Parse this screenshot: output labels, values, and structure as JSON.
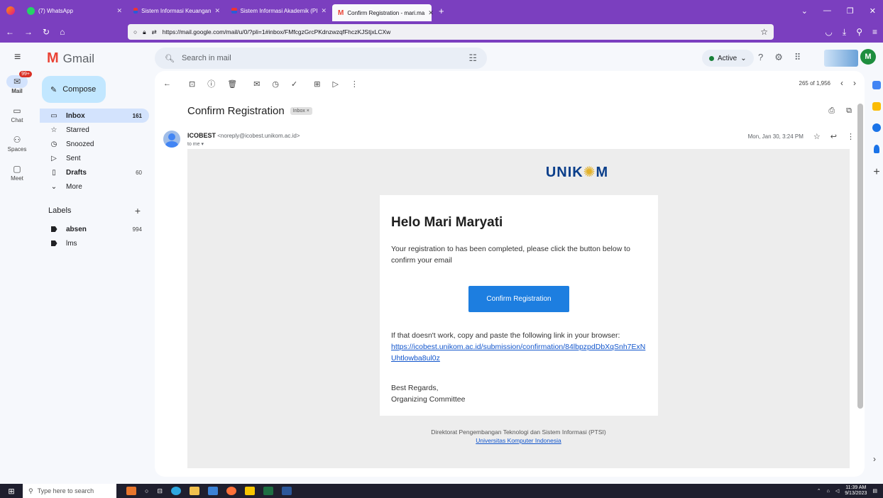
{
  "browser": {
    "tabs": [
      {
        "label": "(7) WhatsApp"
      },
      {
        "label": "Sistem Informasi Keuangan"
      },
      {
        "label": "Sistem Informasi Akademik (PI"
      },
      {
        "label": "Confirm Registration - mari.ma"
      }
    ],
    "url": "https://mail.google.com/mail/u/0/?pli=1#inbox/FMfcgzGrcPKdnzwzqfFhczKJStjxLCXw"
  },
  "gmail": {
    "logo_text": "Gmail",
    "search_placeholder": "Search in mail",
    "status": "Active",
    "avatar_letter": "M",
    "compose_label": "Compose"
  },
  "rail": {
    "mail_badge": "99+",
    "items": [
      {
        "label": "Mail"
      },
      {
        "label": "Chat"
      },
      {
        "label": "Spaces"
      },
      {
        "label": "Meet"
      }
    ]
  },
  "sidebar": {
    "items": [
      {
        "label": "Inbox",
        "count": "161"
      },
      {
        "label": "Starred",
        "count": ""
      },
      {
        "label": "Snoozed",
        "count": ""
      },
      {
        "label": "Sent",
        "count": ""
      },
      {
        "label": "Drafts",
        "count": "60"
      },
      {
        "label": "More",
        "count": ""
      }
    ],
    "labels_title": "Labels",
    "labels": [
      {
        "label": "absen",
        "count": "994"
      },
      {
        "label": "lms",
        "count": ""
      }
    ]
  },
  "message": {
    "pager": "265 of 1,956",
    "subject": "Confirm Registration",
    "chip": "Inbox ×",
    "sender_name": "ICOBEST",
    "sender_email": "<noreply@icobest.unikom.ac.id>",
    "to": "to me ▾",
    "date": "Mon, Jan 30, 3:24 PM"
  },
  "email": {
    "brand_before": "UNIK",
    "brand_after": "M",
    "greeting": "Helo Mari Maryati",
    "intro": "Your registration to has been completed, please click the button below to confirm your email",
    "button": "Confirm Registration",
    "fallback": "If that doesn't work, copy and paste the following link in your browser:",
    "link": "https://icobest.unikom.ac.id/submission/confirmation/84lbpzpdDbXqSnh7ExNUhtlowba8ul0z",
    "regards": "Best Regards,",
    "signature": "Organizing Committee",
    "footer_line": "Direktorat Pengembangan Teknologi dan Sistem Informasi (PTSI)",
    "footer_link": "Universitas Komputer Indonesia"
  },
  "taskbar": {
    "search": "Type here to search",
    "time": "11:39 AM",
    "date": "9/13/2023"
  }
}
